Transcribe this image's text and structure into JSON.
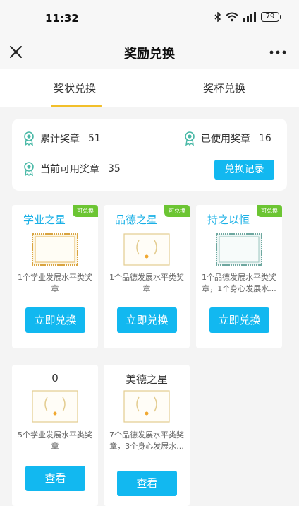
{
  "status_bar": {
    "time": "11:32",
    "battery": "79",
    "icons": [
      "bluetooth-icon",
      "wifi-icon",
      "signal-icon",
      "battery-icon"
    ]
  },
  "nav": {
    "title": "奖励兑换",
    "close_icon": "close-icon",
    "more_icon": "more-icon"
  },
  "tabs": [
    {
      "label": "奖状兑换",
      "active": true
    },
    {
      "label": "奖杯兑换",
      "active": false
    }
  ],
  "summary": {
    "total_label": "累计奖章",
    "total_value": "51",
    "used_label": "已使用奖章",
    "used_value": "16",
    "available_label": "当前可用奖章",
    "available_value": "35",
    "record_button": "兑换记录"
  },
  "awards": [
    {
      "name": "学业之星",
      "badge": "可兑换",
      "desc": "1个学业发展水平类奖章",
      "button": "立即兑换",
      "frame": "gold"
    },
    {
      "name": "品德之星",
      "badge": "可兑换",
      "desc": "1个品德发展水平类奖章",
      "button": "立即兑换",
      "frame": "wreath"
    },
    {
      "name": "持之以恒",
      "badge": "可兑换",
      "desc": "1个品德发展水平类奖章，1个身心发展水...",
      "button": "立即兑换",
      "frame": "teal"
    },
    {
      "name": "0",
      "badge": "",
      "desc": "5个学业发展水平类奖章",
      "button": "查看",
      "frame": "wreath"
    },
    {
      "name": "美德之星",
      "badge": "",
      "desc": "7个品德发展水平类奖章，3个身心发展水...",
      "button": "查看",
      "frame": "wreath"
    }
  ],
  "colors": {
    "accent": "#12b8f0",
    "badge": "#6cc533",
    "tab_underline": "#f2bf2a",
    "award_name": "#1ab0e6"
  }
}
